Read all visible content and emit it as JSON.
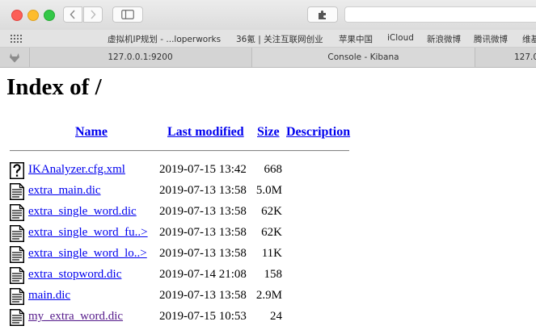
{
  "favorites": [
    {
      "label": "虚拟机IP规划 - ...loperworks"
    },
    {
      "label": "36氪 | 关注互联网创业"
    },
    {
      "label": "苹果中国"
    },
    {
      "label": "iCloud"
    },
    {
      "label": "新浪微博"
    },
    {
      "label": "腾讯微博"
    },
    {
      "label": "维基"
    }
  ],
  "tabs": [
    {
      "label": "127.0.0.1:9200"
    },
    {
      "label": "Console - Kibana"
    },
    {
      "label": "127.0"
    }
  ],
  "page": {
    "title": "Index of /",
    "columns": {
      "name": "Name",
      "modified": "Last modified",
      "size": "Size",
      "description": "Description"
    },
    "files": [
      {
        "name": "IKAnalyzer.cfg.xml",
        "modified": "2019-07-15 13:42",
        "size": "668",
        "icon": "unknown-file-icon",
        "visited": false
      },
      {
        "name": "extra_main.dic",
        "modified": "2019-07-13 13:58",
        "size": "5.0M",
        "icon": "text-file-icon",
        "visited": false
      },
      {
        "name": "extra_single_word.dic",
        "modified": "2019-07-13 13:58",
        "size": "62K",
        "icon": "text-file-icon",
        "visited": false
      },
      {
        "name": "extra_single_word_fu..>",
        "modified": "2019-07-13 13:58",
        "size": "62K",
        "icon": "text-file-icon",
        "visited": false
      },
      {
        "name": "extra_single_word_lo..>",
        "modified": "2019-07-13 13:58",
        "size": "11K",
        "icon": "text-file-icon",
        "visited": false
      },
      {
        "name": "extra_stopword.dic",
        "modified": "2019-07-14 21:08",
        "size": "158",
        "icon": "text-file-icon",
        "visited": false
      },
      {
        "name": "main.dic",
        "modified": "2019-07-13 13:58",
        "size": "2.9M",
        "icon": "text-file-icon",
        "visited": false
      },
      {
        "name": "my_extra_word.dic",
        "modified": "2019-07-15 10:53",
        "size": "24",
        "icon": "text-file-icon",
        "visited": true
      }
    ]
  }
}
